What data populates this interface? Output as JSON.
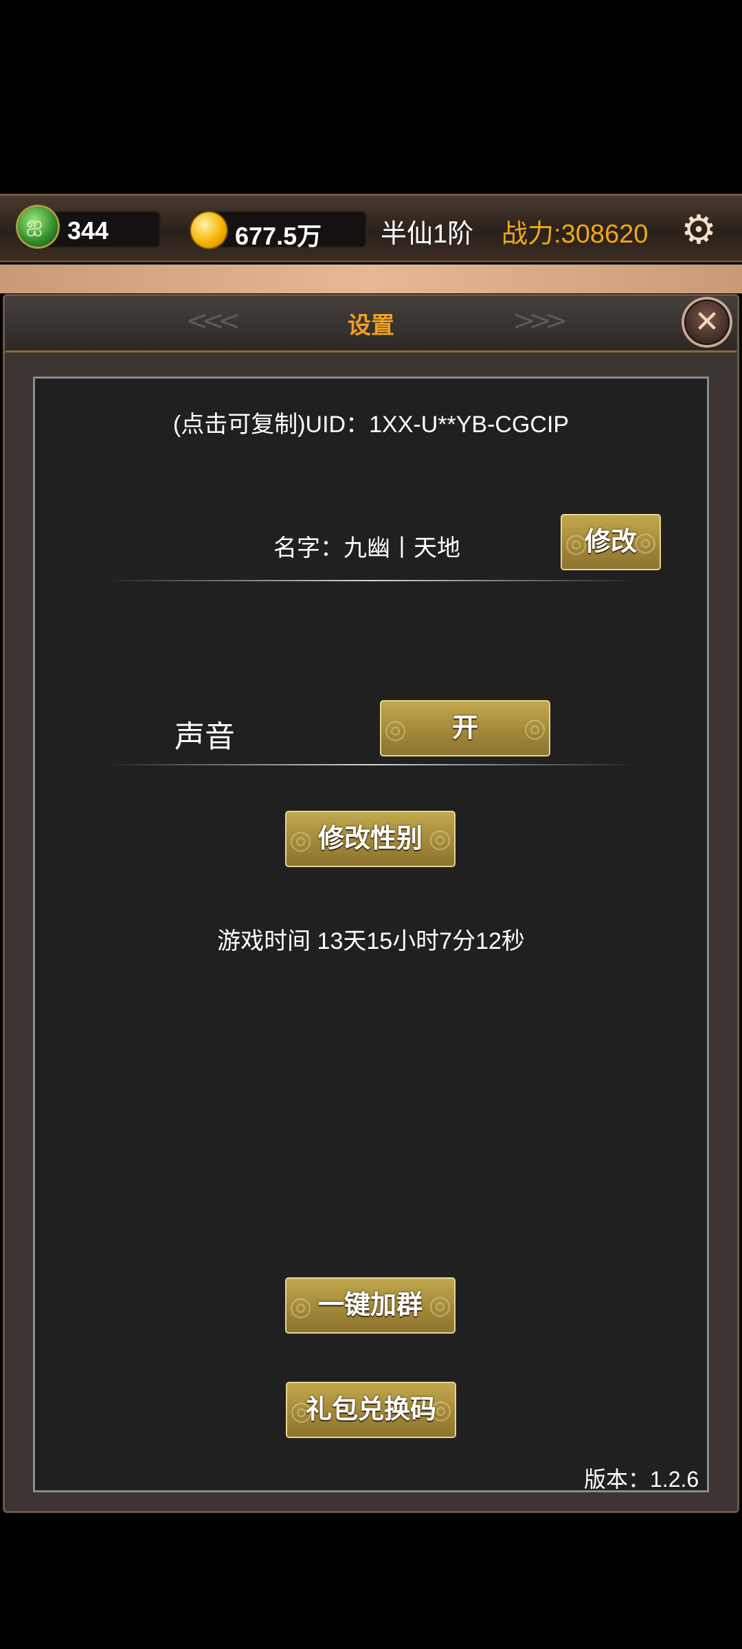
{
  "topbar": {
    "jade_count": "344",
    "gold_amount": "677.5万",
    "rank": "半仙1阶",
    "power": "战力:308620"
  },
  "icons": {
    "jade": "jade-currency-icon",
    "coin": "gold-coin-icon",
    "settings": "gear-icon",
    "close": "close-icon"
  },
  "panel": {
    "title": "设置",
    "uid_text": "(点击可复制)UID：1XX-U**YB-CGCIP",
    "name_text": "名字：九幽丨天地",
    "rename_button": "修改",
    "sound_label": "声音",
    "sound_toggle": "开",
    "change_gender_button": "修改性别",
    "play_time": "游戏时间 13天15小时7分12秒",
    "join_group_button": "一键加群",
    "gift_code_button": "礼包兑换码",
    "version": "版本：1.2.6"
  },
  "colors": {
    "accent_gold": "#f0a020",
    "power_text": "#f0a818",
    "button_gold": "#a08638",
    "panel_bg": "#202020"
  }
}
